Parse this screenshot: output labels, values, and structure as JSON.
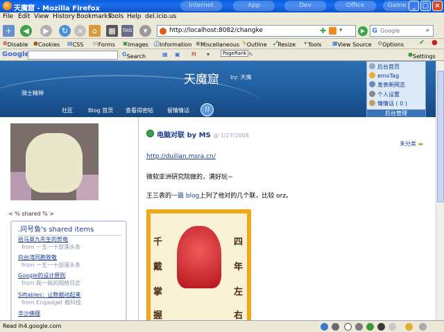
{
  "window": {
    "title": "天魔窟 - Mozilla Firefox",
    "bg_tabs": [
      "Internet",
      "App",
      "Dev",
      "Office",
      "Game"
    ]
  },
  "menu": [
    "File",
    "Edit",
    "View",
    "History",
    "Bookmarks",
    "Tools",
    "Help",
    "del.icio.us"
  ],
  "nav": {
    "url": "http://localhost:8082/changke",
    "search_placeholder": "Google"
  },
  "devbar": [
    "Disable",
    "Cookies",
    "CSS",
    "Forms",
    "Images",
    "Information",
    "Miscellaneous",
    "Outline",
    "Resize",
    "Tools",
    "View Source",
    "Options"
  ],
  "googlebar": {
    "logo": "Google",
    "search": "Search",
    "pagerank": "PageRank",
    "settings": "Settings"
  },
  "site": {
    "title": "天魔窟",
    "by": "by: 天魔",
    "subtitle": "骑士精神",
    "nav": [
      "社区",
      "Blog 首页",
      "查看得密帖",
      "留情情话"
    ]
  },
  "admin": {
    "items": [
      "后台首页",
      "emoTag",
      "发表新网志",
      "个人设置",
      "情情话 ( 0 )"
    ],
    "footer": "后台管理"
  },
  "sidebar": {
    "shared_label": "< % shared % >",
    "shared_title": ".问号鱼's shared items",
    "items": [
      {
        "title": "拾马英九先生的贺电",
        "source": "from 一五一十部落头条"
      },
      {
        "title": "向台湾同胞致敬",
        "source": "from 一五一十部落头条"
      },
      {
        "title": "Google的设计原则",
        "source": "from 耗一耗的网络日志"
      },
      {
        "title": "Siftables：让数据动起来",
        "source": "from Engadget 瘾科技"
      },
      {
        "title": "华沙佛理",
        "source": ""
      }
    ]
  },
  "post": {
    "title": "电脑对联 by MS",
    "date": "@ 1/27/2008",
    "category": "未分类",
    "link": "http://duilian.msra.cn/",
    "p1": "微软亚洲研究院做的，满好玩~",
    "p2_before": "王三表的",
    "p2_link": "一篇 blog",
    "p2_after": "上列了他对的几个联，比较 orz。",
    "poster_left": [
      "千",
      "戴",
      "掌",
      "握"
    ],
    "poster_right": [
      "四",
      "年",
      "左",
      "右"
    ]
  },
  "status": {
    "text": "Read lh4.google.com"
  },
  "colors": {
    "titlebar": "#0b53c7",
    "banner": "#1f5c9e",
    "link": "#1a3c8a"
  }
}
